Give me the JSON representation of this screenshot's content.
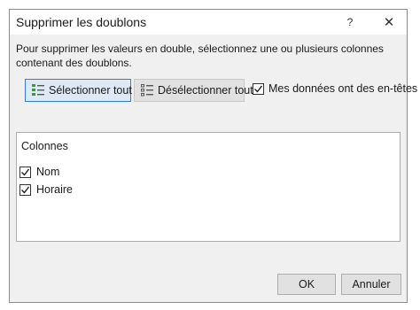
{
  "dialog": {
    "title": "Supprimer les doublons",
    "help_label": "?",
    "close_label": "✕",
    "instructions": "Pour supprimer les valeurs en double, sélectionnez une ou plusieurs colonnes contenant des doublons.",
    "select_all_label": "Sélectionner tout",
    "deselect_all_label": "Désélectionner tout",
    "headers_checkbox": {
      "label": "Mes données ont des en-têtes",
      "checked": true
    },
    "columns": {
      "heading": "Colonnes",
      "items": [
        {
          "label": "Nom",
          "checked": true
        },
        {
          "label": "Horaire",
          "checked": true
        }
      ]
    },
    "ok_label": "OK",
    "cancel_label": "Annuler"
  },
  "colors": {
    "accent": "#2e7fd8",
    "check_green": "#3a9a3a"
  }
}
